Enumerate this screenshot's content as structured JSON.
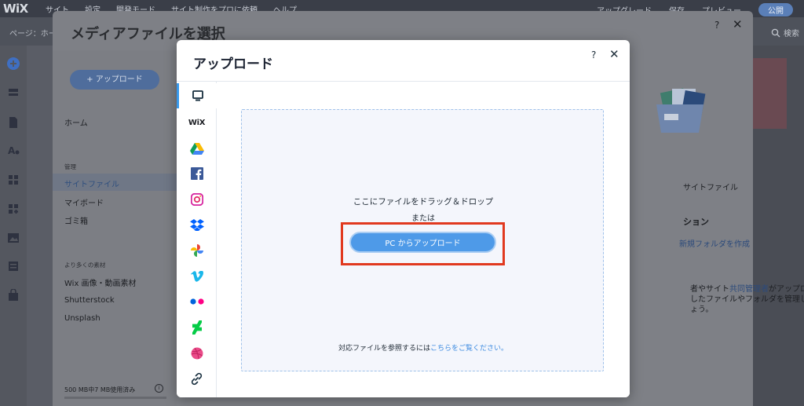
{
  "editor": {
    "logo": "WiX",
    "menu": [
      "サイト",
      "設定",
      "開発モード",
      "サイト制作をプロに依頼",
      "ヘルプ"
    ],
    "right_items": [
      "アップグレード",
      "保存",
      "プレビュー"
    ],
    "publish_label": "公開",
    "page_label": "ページ：ホーム",
    "search_label": "検索"
  },
  "media_manager": {
    "title": "メディアファイルを選択",
    "help_label": "?",
    "close_label": "✕",
    "upload_button": "+ アップロード",
    "home": "ホーム",
    "manage_header": "管理",
    "site_files": "サイトファイル",
    "my_boards": "マイボード",
    "trash": "ゴミ箱",
    "more_header": "より多くの素材",
    "wix_media": "Wix 画像・動画素材",
    "shutterstock": "Shutterstock",
    "unsplash": "Unsplash",
    "storage": "500 MB中7 MB使用済み",
    "right_site_files": "サイトファイル",
    "right_section": "ション",
    "new_folder_link": "新規フォルダを作成",
    "desc_line1_pre": "者やサイト",
    "desc_line1_link": "共同管理者",
    "desc_line1_post": "がアップロ",
    "desc_line2": "したファイルやフォルダを管理し",
    "desc_line3": "ょう。"
  },
  "upload_modal": {
    "title": "アップロード",
    "help_label": "?",
    "close_label": "✕",
    "sources": [
      {
        "name": "my-computer",
        "icon": "monitor-icon"
      },
      {
        "name": "wix",
        "icon": "wix-logo-icon",
        "label": "WiX"
      },
      {
        "name": "google-drive",
        "icon": "google-drive-icon"
      },
      {
        "name": "facebook",
        "icon": "facebook-icon"
      },
      {
        "name": "instagram",
        "icon": "instagram-icon"
      },
      {
        "name": "dropbox",
        "icon": "dropbox-icon"
      },
      {
        "name": "google-photos",
        "icon": "google-photos-icon"
      },
      {
        "name": "vimeo",
        "icon": "vimeo-icon"
      },
      {
        "name": "flickr",
        "icon": "flickr-icon"
      },
      {
        "name": "deviantart",
        "icon": "deviantart-icon"
      },
      {
        "name": "dribbble",
        "icon": "dribbble-icon"
      },
      {
        "name": "link",
        "icon": "link-icon"
      }
    ],
    "drop_line1": "ここにファイルをドラッグ＆ドロップ",
    "drop_line2": "または",
    "pc_upload_button": "PC からアップロード",
    "footer_text": "対応ファイルを参照するには",
    "footer_link": "こちらをご覧ください。"
  },
  "colors": {
    "accent": "#3899ec",
    "button": "#4e9ae8",
    "highlight": "#e1391f",
    "link": "#3d8be0"
  }
}
